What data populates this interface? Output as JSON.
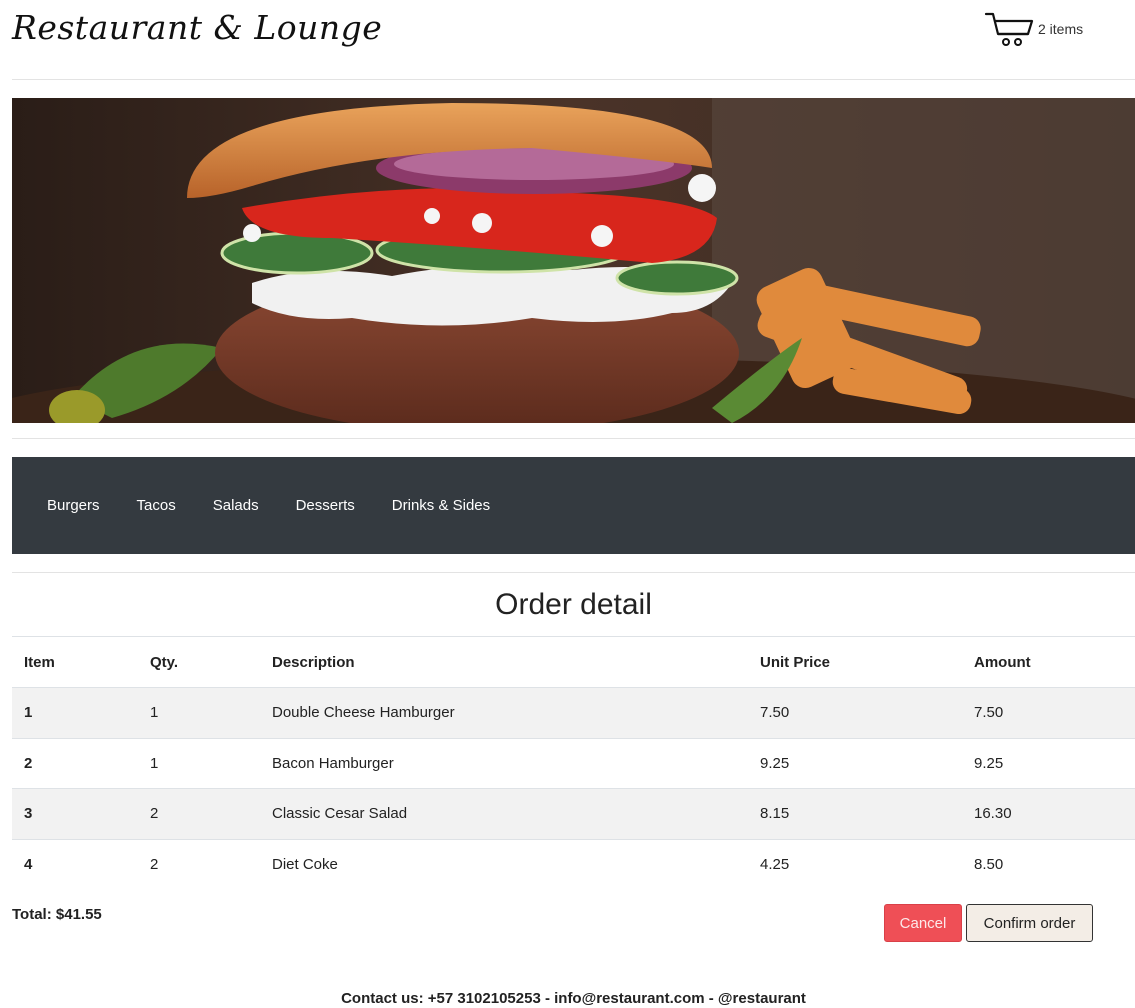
{
  "header": {
    "brand": "Restaurant & Lounge",
    "cart_icon": "shopping-cart-icon",
    "cart_count": "2 items"
  },
  "hero": {
    "icon": "burger-photo"
  },
  "nav": {
    "items": [
      {
        "label": "Burgers"
      },
      {
        "label": "Tacos"
      },
      {
        "label": "Salads"
      },
      {
        "label": "Desserts"
      },
      {
        "label": "Drinks & Sides"
      }
    ]
  },
  "order": {
    "title": "Order detail",
    "columns": [
      "Item",
      "Qty.",
      "Description",
      "Unit Price",
      "Amount"
    ],
    "rows": [
      {
        "item": "1",
        "qty": "1",
        "description": "Double Cheese Hamburger",
        "unit_price": "7.50",
        "amount": "7.50"
      },
      {
        "item": "2",
        "qty": "1",
        "description": "Bacon Hamburger",
        "unit_price": "9.25",
        "amount": "9.25"
      },
      {
        "item": "3",
        "qty": "2",
        "description": "Classic Cesar Salad",
        "unit_price": "8.15",
        "amount": "16.30"
      },
      {
        "item": "4",
        "qty": "2",
        "description": "Diet Coke",
        "unit_price": "4.25",
        "amount": "8.50"
      }
    ],
    "total": "Total: $41.55",
    "cancel_label": "Cancel",
    "confirm_label": "Confirm order"
  },
  "footer": {
    "contact": "Contact us: +57 3102105253 - info@restaurant.com - @restaurant"
  },
  "colors": {
    "navbar": "#343a40",
    "cancel": "#ef4f56",
    "confirm": "#f3ede6",
    "row_stripe": "#f2f2f2"
  }
}
